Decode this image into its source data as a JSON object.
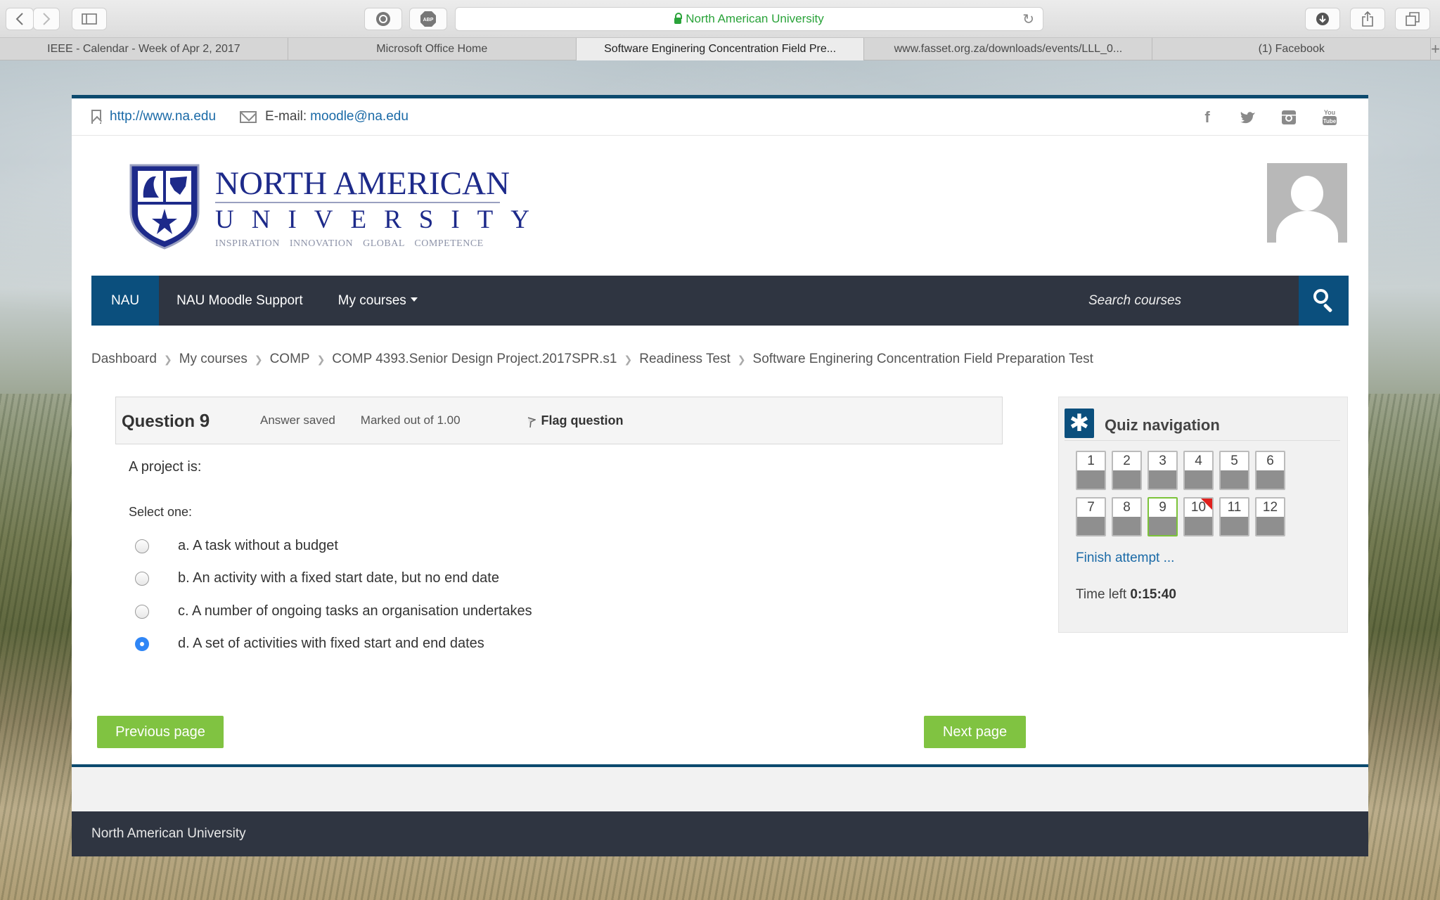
{
  "browser": {
    "address": "North American University",
    "tabs": [
      {
        "label": "IEEE - Calendar - Week of Apr 2, 2017",
        "active": false
      },
      {
        "label": "Microsoft Office Home",
        "active": false
      },
      {
        "label": "Software Enginering Concentration Field Pre...",
        "active": true
      },
      {
        "label": "www.fasset.org.za/downloads/events/LLL_0...",
        "active": false
      },
      {
        "label": "(1) Facebook",
        "active": false
      }
    ]
  },
  "topbar": {
    "website": "http://www.na.edu",
    "email_label": "E-mail: ",
    "email": "moodle@na.edu",
    "social": [
      "facebook-icon",
      "twitter-icon",
      "instagram-icon",
      "youtube-icon"
    ]
  },
  "logo": {
    "line1": "NORTH AMERICAN",
    "line2": "UNIVERSITY",
    "tagline": "INSPIRATION   INNOVATION   GLOBAL COMPETENCE"
  },
  "nav": {
    "items": [
      "NAU",
      "NAU Moodle Support",
      "My courses"
    ],
    "search_placeholder": "Search courses"
  },
  "breadcrumb": [
    "Dashboard",
    "My courses",
    "COMP",
    "COMP 4393.Senior Design Project.2017SPR.s1",
    "Readiness Test",
    "Software Enginering Concentration Field Preparation Test"
  ],
  "question": {
    "label": "Question",
    "number": "9",
    "status": "Answer saved",
    "marks": "Marked out of 1.00",
    "flag_label": "Flag question",
    "text": "A project is:",
    "select_one": "Select one:",
    "options": [
      {
        "label": "a. A task without a budget",
        "selected": false
      },
      {
        "label": "b. An activity with a fixed start date, but no end date",
        "selected": false
      },
      {
        "label": "c. A number of ongoing tasks an organisation undertakes",
        "selected": false
      },
      {
        "label": "d. A set of activities with fixed start and end dates",
        "selected": true
      }
    ]
  },
  "buttons": {
    "previous": "Previous page",
    "next": "Next page"
  },
  "quiz_nav": {
    "title": "Quiz navigation",
    "questions": [
      "1",
      "2",
      "3",
      "4",
      "5",
      "6",
      "7",
      "8",
      "9",
      "10",
      "11",
      "12"
    ],
    "current": "9",
    "flagged": "10",
    "finish": "Finish attempt ...",
    "time_label": "Time left ",
    "time_value": "0:15:40"
  },
  "footer": {
    "text": "North American University"
  },
  "colors": {
    "primary": "#0b4f7d",
    "nav_bg": "#2f3541",
    "button": "#80c341",
    "link": "#1a6aa7",
    "flag": "#e0201d"
  }
}
